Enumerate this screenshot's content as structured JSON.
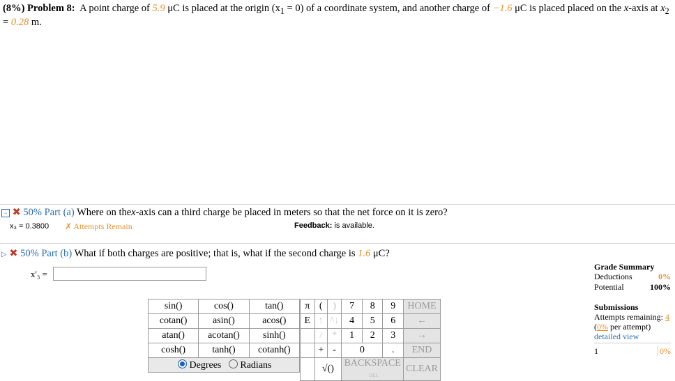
{
  "problem": {
    "header": "(8%) Problem 8:",
    "text1": "A point charge of",
    "q1": "5.9",
    "unit1": "μC is placed at the origin (x",
    "sub1": "1",
    "text2": "= 0) of a coordinate system, and another charge of",
    "q2": "−1.6",
    "text3": "μC is placed placed on the",
    "xaxis": "x",
    "text4": "-axis at",
    "x2": "x",
    "sub2": "2",
    "line2_eq": "=",
    "x2_val": "0.28",
    "line2_unit": "m."
  },
  "part_a": {
    "label": "50% Part (a)",
    "question_pre": "Where on the",
    "question_x": "x",
    "question_post": "-axis can a third charge be placed in meters so that the net force on it is zero?",
    "answer": "x₃ = 0.3800",
    "attempts": "✗ Attempts Remain",
    "feedback_label": "Feedback:",
    "feedback_text": "is available."
  },
  "part_b": {
    "label": "50% Part (b)",
    "question": "What if both charges are positive; that is, what if the second charge is",
    "q": "1.6",
    "question_unit": "μC?",
    "input_label": "x'₃ =",
    "input_value": ""
  },
  "keypad": {
    "functions": [
      [
        "sin()",
        "cos()",
        "tan()"
      ],
      [
        "cotan()",
        "asin()",
        "acos()"
      ],
      [
        "atan()",
        "acotan()",
        "sinh()"
      ],
      [
        "cosh()",
        "tanh()",
        "cotanh()"
      ]
    ],
    "degrees": "Degrees",
    "radians": "Radians",
    "pi": "π",
    "e": "E",
    "lparen": "(",
    "rparen": ")",
    "up": "↑",
    "caret": "^",
    "down": "↓",
    "slash": "/",
    "star": "*",
    "plus": "+",
    "minus": "-",
    "sqrt": "√()",
    "digits": [
      "7",
      "8",
      "9",
      "4",
      "5",
      "6",
      "1",
      "2",
      "3",
      "0",
      "."
    ],
    "home": "HOME",
    "left": "←",
    "right": "→",
    "end": "END",
    "backspace": "BACKSPACE",
    "del": "DEL",
    "clear": "CLEAR"
  },
  "grade": {
    "title": "Grade Summary",
    "deductions_label": "Deductions",
    "deductions_val": "0%",
    "potential_label": "Potential",
    "potential_val": "100%",
    "submissions_title": "Submissions",
    "attempts_label": "Attempts remaining:",
    "attempts_val": "4",
    "per_attempt_pct": "0%",
    "per_attempt_text": "per attempt)",
    "detailed": "detailed view",
    "row_num": "1",
    "row_val": "0%"
  }
}
